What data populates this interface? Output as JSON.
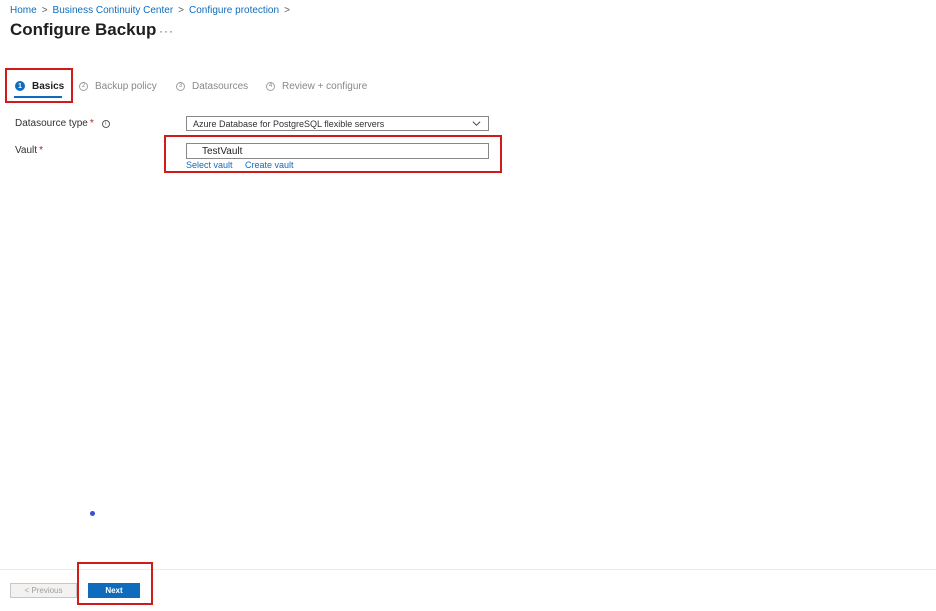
{
  "breadcrumb": {
    "items": [
      "Home",
      "Business Continuity Center",
      "Configure protection"
    ],
    "separator": ">"
  },
  "page": {
    "title": "Configure Backup",
    "more": "···"
  },
  "tabs": [
    {
      "step": "1",
      "label": "Basics",
      "active": true
    },
    {
      "step": "2",
      "label": "Backup policy",
      "active": false
    },
    {
      "step": "3",
      "label": "Datasources",
      "active": false
    },
    {
      "step": "4",
      "label": "Review + configure",
      "active": false
    }
  ],
  "form": {
    "datasource_type": {
      "label": "Datasource type",
      "required_mark": "*",
      "info_icon": "info-icon",
      "value": "Azure Database for PostgreSQL flexible servers"
    },
    "vault": {
      "label": "Vault",
      "required_mark": "*",
      "value": "TestVault",
      "select_link": "Select vault",
      "create_link": "Create vault"
    }
  },
  "footer": {
    "previous_label": "< Previous",
    "next_label": "Next"
  },
  "colors": {
    "accent": "#0f6cbd",
    "highlight": "#d11a1a",
    "required": "#a4262c"
  }
}
